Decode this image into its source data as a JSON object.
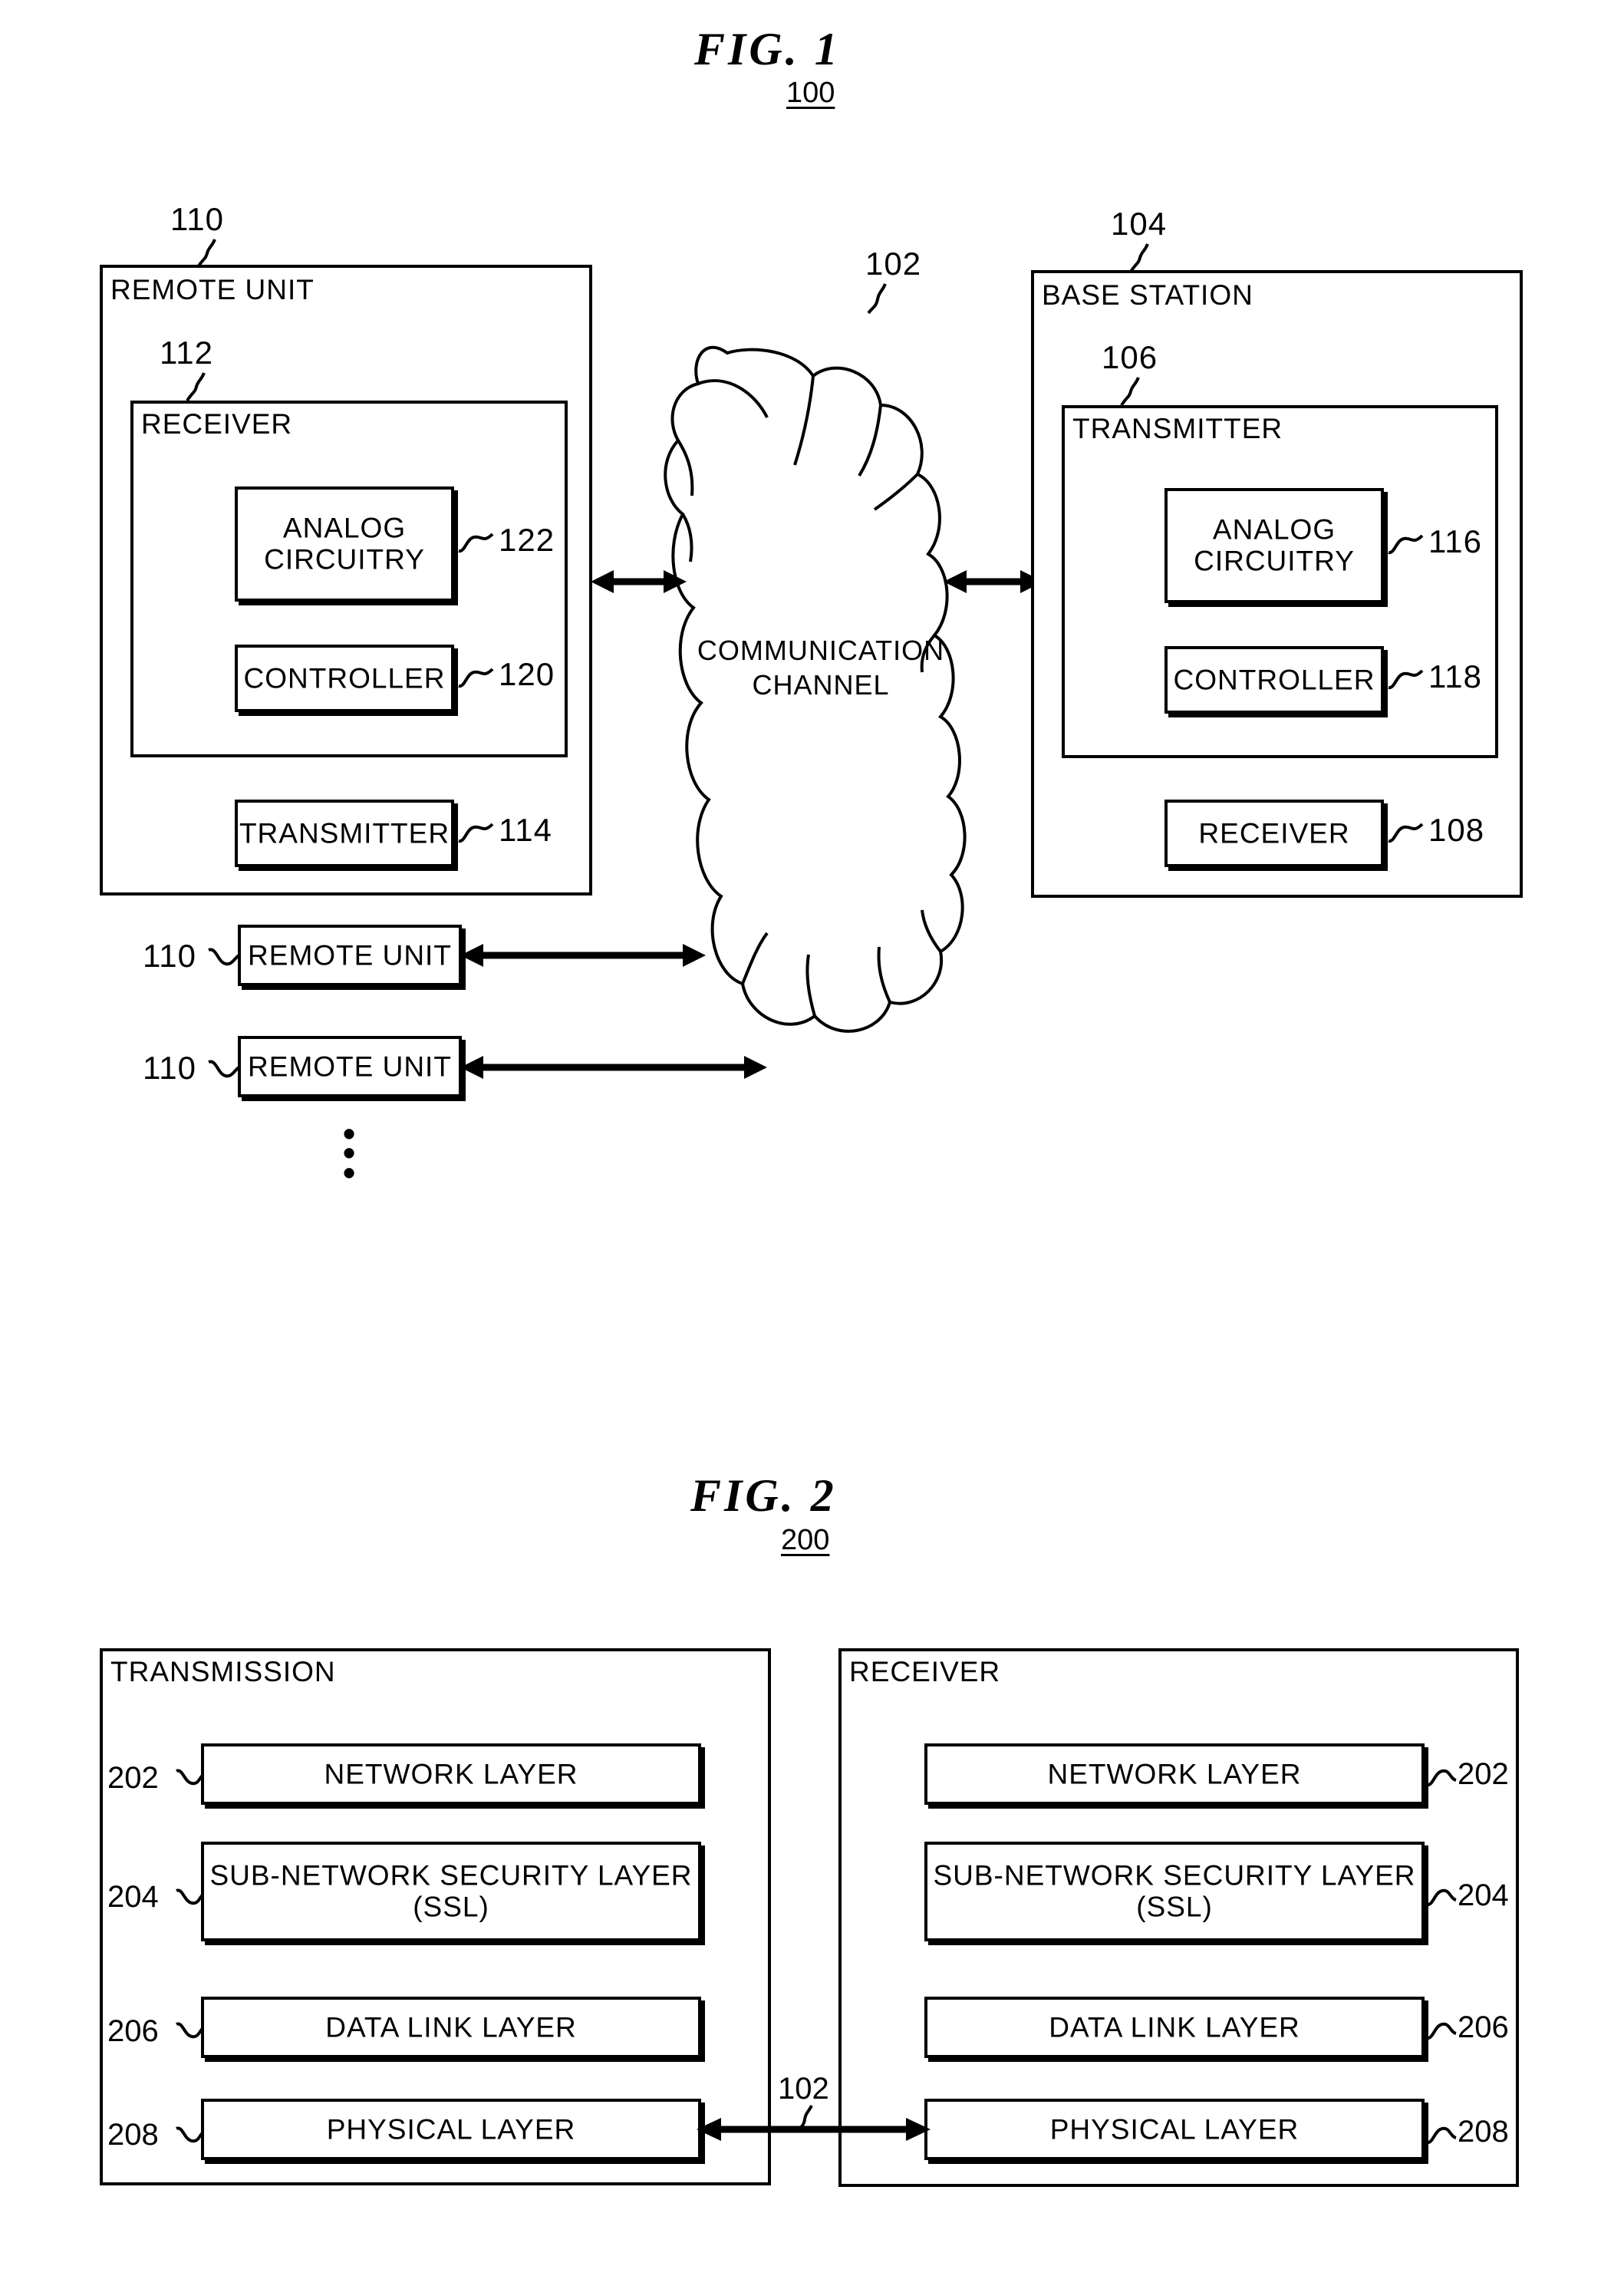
{
  "figure1": {
    "title": "FIG.   1",
    "number": "100",
    "remote_unit": {
      "title": "REMOTE UNIT",
      "ref": "110",
      "receiver": {
        "title": "RECEIVER",
        "ref": "112",
        "analog_circuitry": {
          "label": "ANALOG\nCIRCUITRY",
          "ref": "122"
        },
        "controller": {
          "label": "CONTROLLER",
          "ref": "120"
        }
      },
      "transmitter": {
        "label": "TRANSMITTER",
        "ref": "114"
      }
    },
    "channel": {
      "label": "COMMUNICATION\nCHANNEL",
      "ref": "102"
    },
    "base_station": {
      "title": "BASE STATION",
      "ref": "104",
      "transmitter": {
        "title": "TRANSMITTER",
        "ref": "106",
        "analog_circuitry": {
          "label": "ANALOG\nCIRCUITRY",
          "ref": "116"
        },
        "controller": {
          "label": "CONTROLLER",
          "ref": "118"
        }
      },
      "receiver": {
        "label": "RECEIVER",
        "ref": "108"
      }
    },
    "extra_remote_units": [
      {
        "label": "REMOTE  UNIT",
        "ref": "110"
      },
      {
        "label": "REMOTE  UNIT",
        "ref": "110"
      }
    ],
    "ellipsis": "•\n•\n•"
  },
  "figure2": {
    "title": "FIG.   2",
    "number": "200",
    "channel_ref": "102",
    "transmission": {
      "title": "TRANSMISSION",
      "layers": [
        {
          "label": "NETWORK LAYER",
          "ref": "202"
        },
        {
          "label": "SUB-NETWORK  SECURITY  LAYER\n(SSL)",
          "ref": "204"
        },
        {
          "label": "DATA LINK LAYER",
          "ref": "206"
        },
        {
          "label": "PHYSICAL LAYER",
          "ref": "208"
        }
      ]
    },
    "receiver": {
      "title": "RECEIVER",
      "layers": [
        {
          "label": "NETWORK LAYER",
          "ref": "202"
        },
        {
          "label": "SUB-NETWORK  SECURITY  LAYER\n(SSL)",
          "ref": "204"
        },
        {
          "label": "DATA LINK LAYER",
          "ref": "206"
        },
        {
          "label": "PHYSICAL LAYER",
          "ref": "208"
        }
      ]
    }
  }
}
